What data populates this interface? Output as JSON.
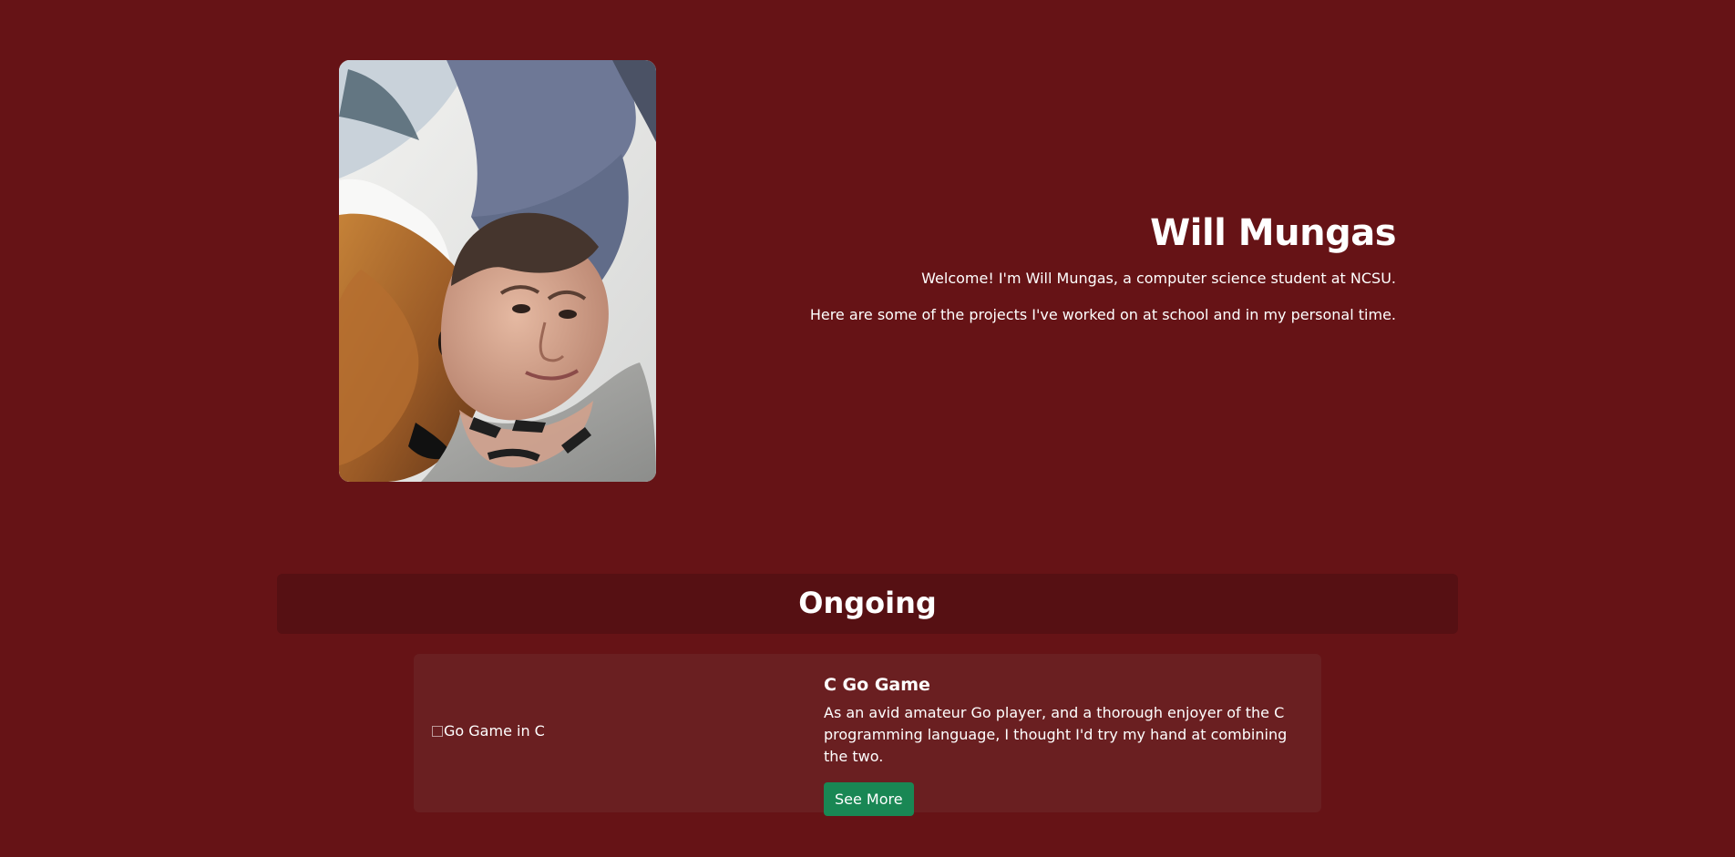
{
  "hero": {
    "portrait_alt": "Will Mungas with a dog",
    "name": "Will Mungas",
    "intro_paragraphs": [
      "Welcome! I'm Will Mungas, a computer science student at NCSU.",
      "Here are some of the projects I've worked on at school and in my personal time."
    ]
  },
  "sections": [
    {
      "title": "Ongoing",
      "projects": [
        {
          "image_alt": "Go Game in C",
          "title": "C Go Game",
          "description": "As an avid amateur Go player, and a thorough enjoyer of the C programming language, I thought I'd try my hand at combining the two.",
          "button_label": "See More",
          "button_color": "#198754"
        }
      ]
    }
  ],
  "colors": {
    "page_background": "#661316",
    "section_header_background": "#561013",
    "card_background": "#6a1f21",
    "text": "#ffffff"
  }
}
